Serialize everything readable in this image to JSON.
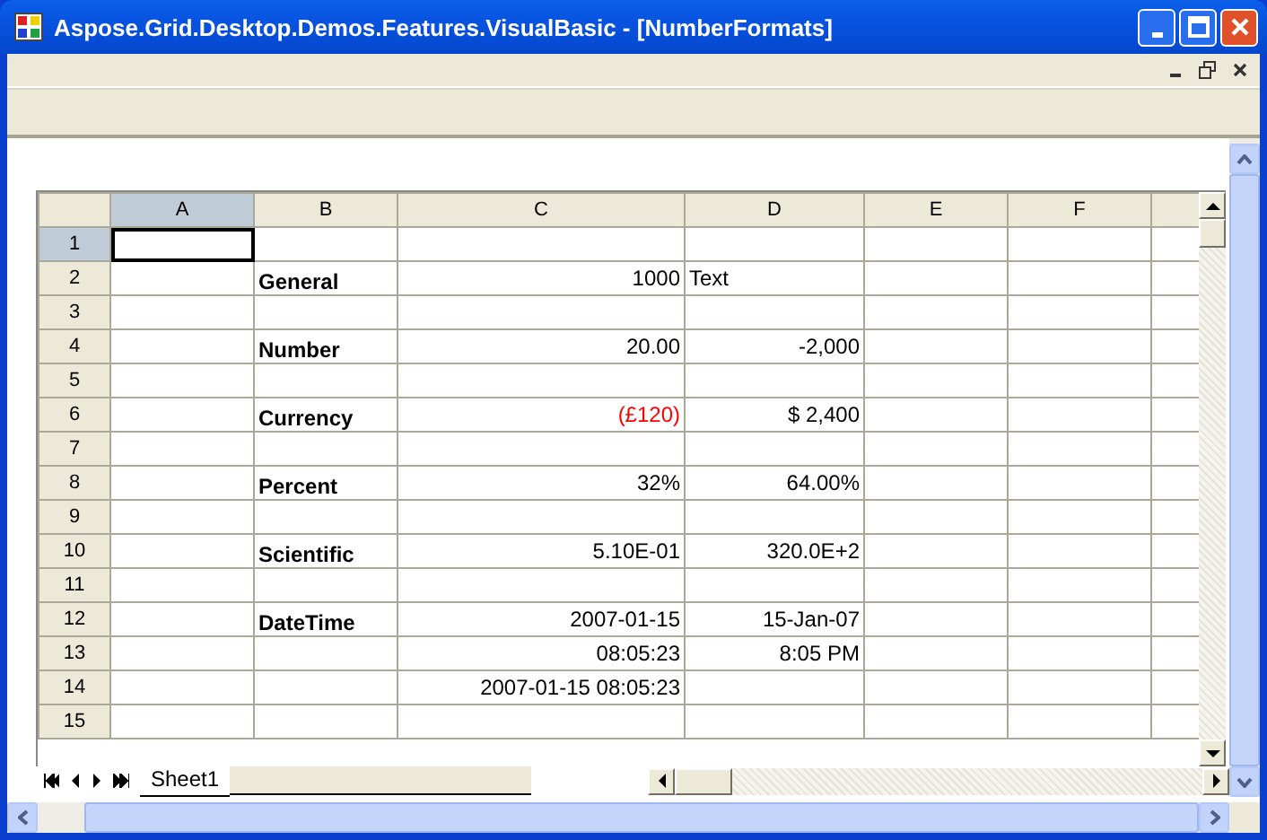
{
  "window": {
    "title": "Aspose.Grid.Desktop.Demos.Features.VisualBasic - [NumberFormats]"
  },
  "columns": [
    {
      "label": "A",
      "selected": true
    },
    {
      "label": "B",
      "selected": false
    },
    {
      "label": "C",
      "selected": false
    },
    {
      "label": "D",
      "selected": false
    },
    {
      "label": "E",
      "selected": false
    },
    {
      "label": "F",
      "selected": false
    }
  ],
  "rows": [
    {
      "label": "1",
      "selected": true
    },
    {
      "label": "2",
      "selected": false,
      "cells": {
        "B": {
          "text": "General",
          "kind": "label"
        },
        "C": {
          "text": "1000",
          "kind": "number"
        },
        "D": {
          "text": "Text",
          "kind": "text"
        }
      }
    },
    {
      "label": "3",
      "selected": false
    },
    {
      "label": "4",
      "selected": false,
      "cells": {
        "B": {
          "text": "Number",
          "kind": "label"
        },
        "C": {
          "text": "20.00",
          "kind": "number"
        },
        "D": {
          "text": "-2,000",
          "kind": "number"
        }
      }
    },
    {
      "label": "5",
      "selected": false
    },
    {
      "label": "6",
      "selected": false,
      "cells": {
        "B": {
          "text": "Currency",
          "kind": "label"
        },
        "C": {
          "text": "(£120)",
          "kind": "number",
          "color": "#ff0000"
        },
        "D": {
          "text": "$ 2,400",
          "kind": "number"
        }
      }
    },
    {
      "label": "7",
      "selected": false
    },
    {
      "label": "8",
      "selected": false,
      "cells": {
        "B": {
          "text": "Percent",
          "kind": "label"
        },
        "C": {
          "text": "32%",
          "kind": "number"
        },
        "D": {
          "text": "64.00%",
          "kind": "number"
        }
      }
    },
    {
      "label": "9",
      "selected": false
    },
    {
      "label": "10",
      "selected": false,
      "cells": {
        "B": {
          "text": "Scientific",
          "kind": "label"
        },
        "C": {
          "text": "5.10E-01",
          "kind": "number"
        },
        "D": {
          "text": "320.0E+2",
          "kind": "number"
        }
      }
    },
    {
      "label": "11",
      "selected": false
    },
    {
      "label": "12",
      "selected": false,
      "cells": {
        "B": {
          "text": "DateTime",
          "kind": "label"
        },
        "C": {
          "text": "2007-01-15",
          "kind": "number"
        },
        "D": {
          "text": "15-Jan-07",
          "kind": "number"
        }
      }
    },
    {
      "label": "13",
      "selected": false,
      "cells": {
        "C": {
          "text": "08:05:23",
          "kind": "number"
        },
        "D": {
          "text": "8:05 PM",
          "kind": "number"
        }
      }
    },
    {
      "label": "14",
      "selected": false,
      "cells": {
        "C": {
          "text": "2007-01-15 08:05:23",
          "kind": "number"
        }
      }
    },
    {
      "label": "15",
      "selected": false
    }
  ],
  "sheet_tabs": [
    {
      "label": "Sheet1",
      "selected": true
    }
  ]
}
